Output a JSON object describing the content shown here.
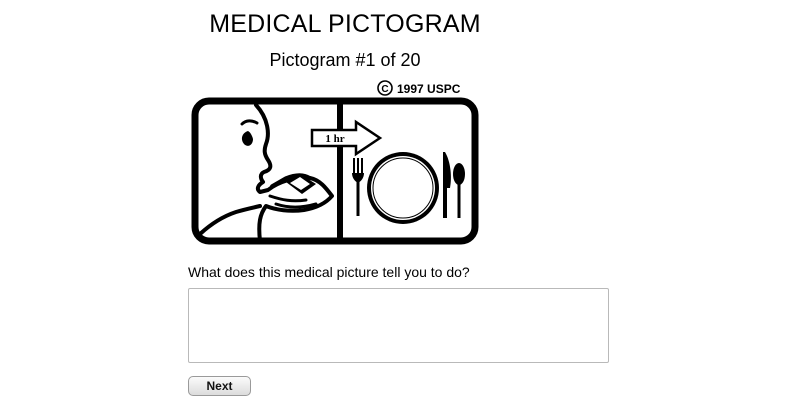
{
  "header": {
    "title": "MEDICAL PICTOGRAM",
    "counter": "Pictogram #1 of 20"
  },
  "pictogram": {
    "copyright": "1997 USPC",
    "copyright_symbol": "C",
    "arrow_label": "1 hr",
    "left_panel_icon": "person-taking-pill-icon",
    "right_panel_icon": "meal-place-setting-icon"
  },
  "form": {
    "question": "What does this medical picture tell you to do?",
    "answer_value": "",
    "answer_placeholder": "",
    "next_label": "Next"
  }
}
